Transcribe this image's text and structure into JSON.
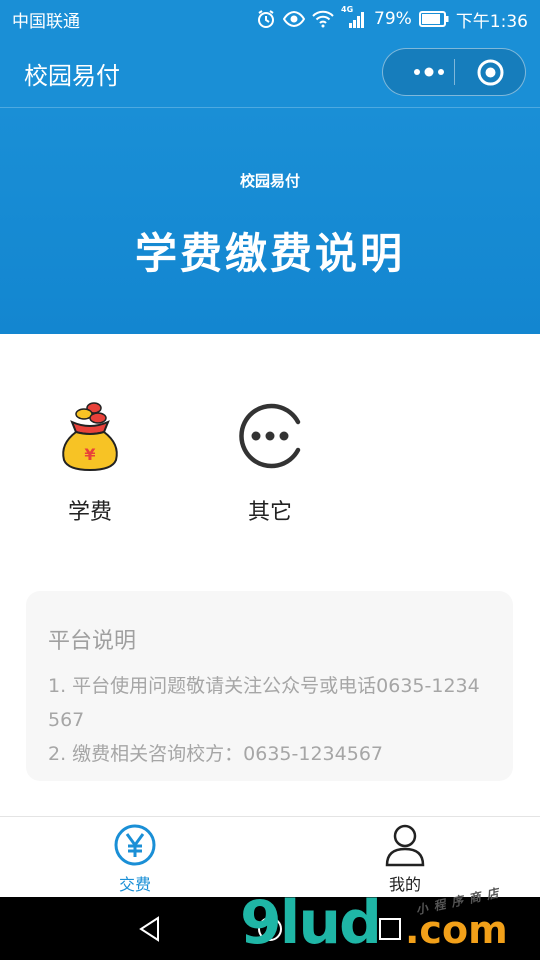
{
  "status_bar": {
    "carrier": "中国联通",
    "network_badge": "4G",
    "battery": "79%",
    "time": "下午1:36",
    "icons": [
      "alarm-icon",
      "eye-icon",
      "wifi-icon",
      "signal-icon",
      "battery-icon"
    ]
  },
  "nav": {
    "title": "校园易付",
    "more_icon": "more-dots-icon",
    "close_icon": "target-close-icon"
  },
  "banner": {
    "subtitle": "校园易付",
    "title": "学费缴费说明"
  },
  "categories": [
    {
      "label": "学费",
      "icon": "money-bag-icon"
    },
    {
      "label": "其它",
      "icon": "more-circle-icon"
    }
  ],
  "notice": {
    "title": "平台说明",
    "lines": [
      "1. 平台使用问题敬请关注公众号或电话0635-1234567",
      "2. 缴费相关咨询校方：0635-1234567"
    ]
  },
  "tabbar": {
    "items": [
      {
        "label": "交费",
        "icon": "yen-circle-icon",
        "active": true
      },
      {
        "label": "我的",
        "icon": "user-icon",
        "active": false
      }
    ]
  },
  "colors": {
    "primary": "#1a8fd6",
    "notice_bg": "#f7f7f7",
    "bag_yellow": "#f7c325",
    "bag_red": "#e8413a"
  },
  "watermark": {
    "main": "9lud",
    "suffix": ".com",
    "small": "小程序商店"
  }
}
